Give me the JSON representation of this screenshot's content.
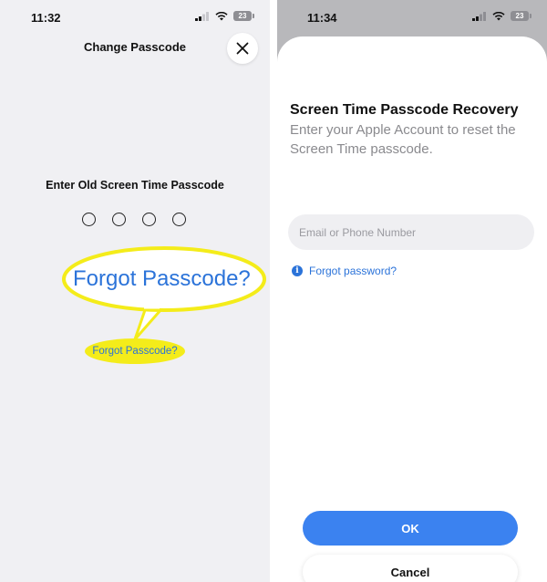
{
  "left_screen": {
    "status": {
      "time": "11:32",
      "battery": "23"
    },
    "title": "Change Passcode",
    "prompt": "Enter Old Screen Time Passcode",
    "passcode_dots": 4,
    "forgot_link": "Forgot Passcode?",
    "callout_text": "Forgot Passcode?"
  },
  "right_screen": {
    "status": {
      "time": "11:34",
      "battery": "23"
    },
    "title": "Screen Time Passcode Recovery",
    "subtitle": "Enter your Apple Account to reset the Screen Time passcode.",
    "email_placeholder": "Email or Phone Number",
    "forgot_password": "Forgot password?",
    "ok_label": "OK",
    "cancel_label": "Cancel"
  },
  "colors": {
    "accent_blue": "#2b73d9",
    "highlight_yellow": "#f4ec1a",
    "ok_button": "#3b82f0"
  }
}
